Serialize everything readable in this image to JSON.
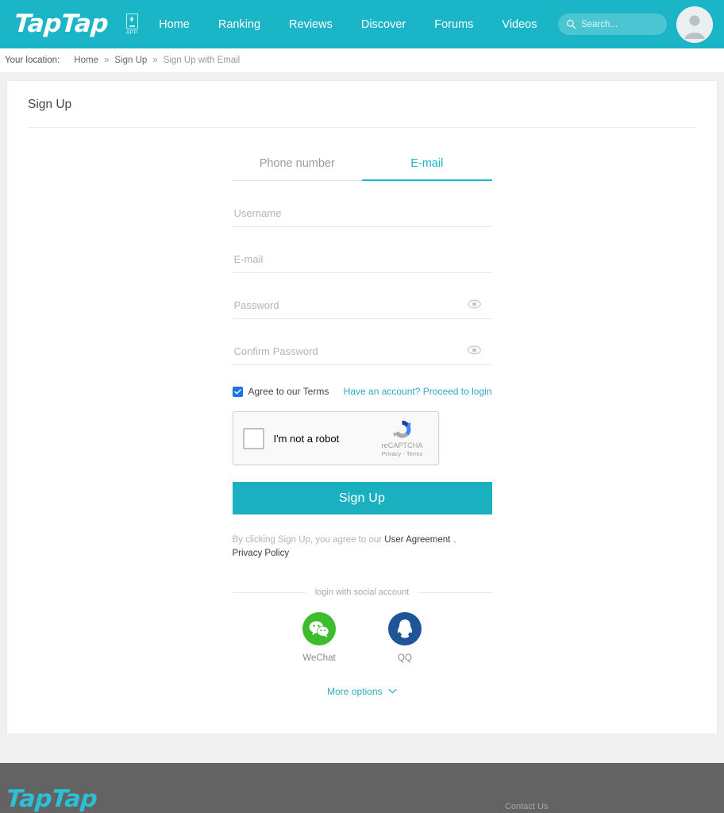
{
  "header": {
    "logo_text": "TapTap",
    "app_download_label": "APP",
    "app_download_icon": "phone-download-icon",
    "nav_items": [
      {
        "label": "Home"
      },
      {
        "label": "Ranking"
      },
      {
        "label": "Reviews"
      },
      {
        "label": "Discover"
      },
      {
        "label": "Forums"
      },
      {
        "label": "Videos"
      }
    ],
    "search": {
      "placeholder": "Search...",
      "value": "",
      "icon": "search-icon"
    },
    "avatar_icon": "user-avatar-icon",
    "accent_color": "#1ab5c6"
  },
  "breadcrumb": {
    "label": "Your location:",
    "items": [
      {
        "label": "Home",
        "link": true
      },
      {
        "label": "Sign Up",
        "link": true
      },
      {
        "label": "Sign Up with Email",
        "link": false
      }
    ],
    "separator": "»"
  },
  "card": {
    "title": "Sign Up"
  },
  "form": {
    "tabs": [
      {
        "label": "Phone number",
        "active": false
      },
      {
        "label": "E-mail",
        "active": true
      }
    ],
    "fields": [
      {
        "name": "username",
        "placeholder": "Username",
        "value": "",
        "type": "text",
        "has_eye": false
      },
      {
        "name": "email",
        "placeholder": "E-mail",
        "value": "",
        "type": "text",
        "has_eye": false
      },
      {
        "name": "password",
        "placeholder": "Password",
        "value": "",
        "type": "password",
        "has_eye": true
      },
      {
        "name": "confirm-password",
        "placeholder": "Confirm Password",
        "value": "",
        "type": "password",
        "has_eye": true
      }
    ],
    "terms": {
      "checked": true,
      "label": "Agree to our Terms",
      "login_link": "Have an account? Proceed to login"
    },
    "recaptcha": {
      "checkbox_label": "I'm not a robot",
      "brand": "reCAPTCHA",
      "legal": "Privacy - Terms",
      "checked": false
    },
    "submit_label": "Sign Up",
    "agreement": {
      "prefix": "By clicking Sign Up, you agree to our ",
      "link1": "User Agreement",
      "middle": " 、",
      "link2": "Privacy Policy"
    }
  },
  "social": {
    "divider_text": "login with social account",
    "accounts": [
      {
        "name": "WeChat",
        "icon": "wechat-icon",
        "color": "#3dbd2e"
      },
      {
        "name": "QQ",
        "icon": "qq-penguin-icon",
        "color": "#1f5497"
      }
    ],
    "more_options": "More options",
    "more_options_icon": "chevron-down-icon"
  },
  "footer": {
    "logo_text": "TapTap",
    "contact_label": "Contact Us",
    "background": "#636363"
  }
}
